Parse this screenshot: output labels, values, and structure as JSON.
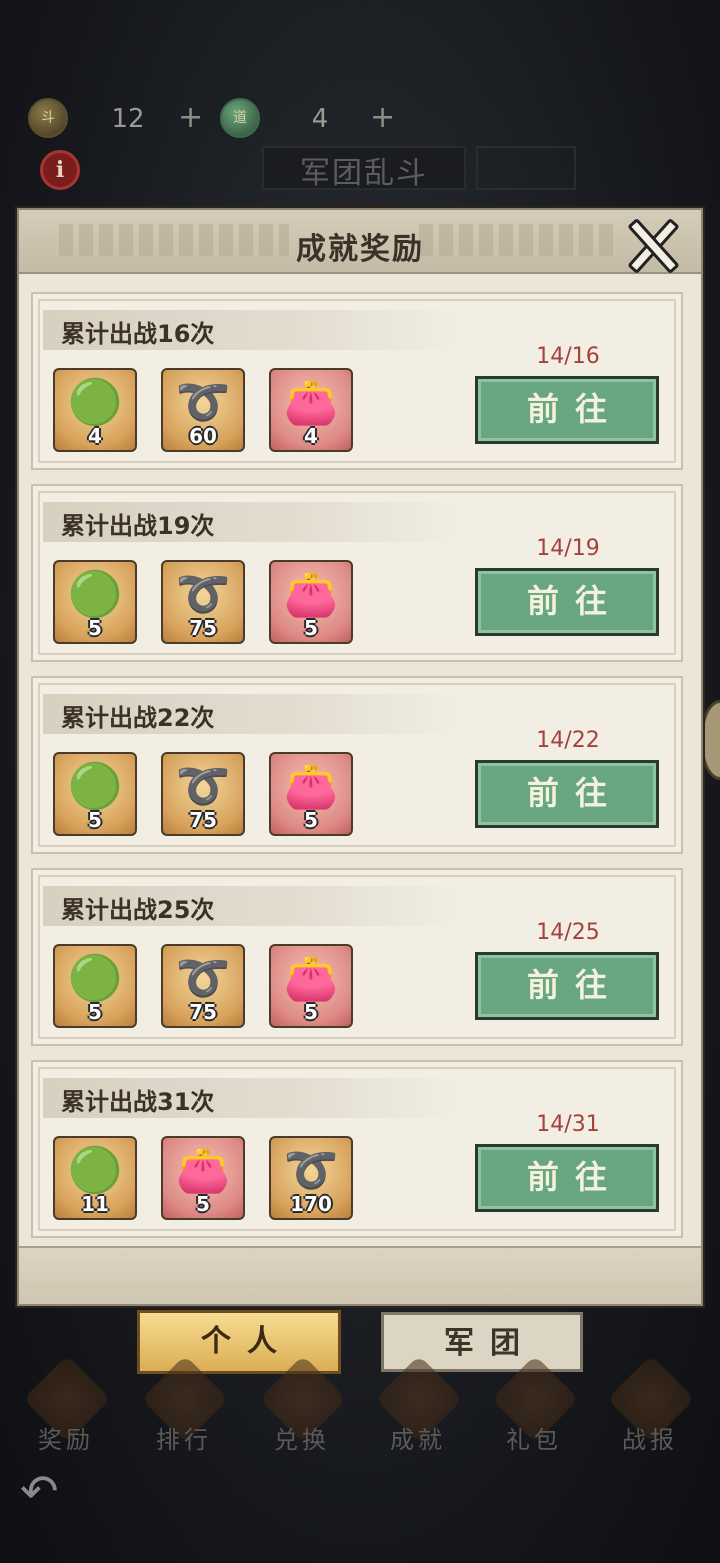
{
  "resources": [
    {
      "name": "斗",
      "value": "12",
      "plus": "+",
      "icon": "dou-token-icon"
    },
    {
      "name": "道",
      "value": "4",
      "plus": "+",
      "icon": "dao-token-icon"
    }
  ],
  "header": {
    "info_label": "i",
    "page_title": "军团乱斗"
  },
  "panel": {
    "title": "成就奖励",
    "go_label": "前往",
    "achievements": [
      {
        "title": "累计出战16次",
        "progress": "14/16",
        "rewards": [
          {
            "icon": "jade-pendant-icon",
            "qty": "4",
            "bg": "gold"
          },
          {
            "icon": "rope-bracelet-icon",
            "qty": "60",
            "bg": "gold"
          },
          {
            "icon": "treasure-bag-icon",
            "qty": "4",
            "bg": "red"
          }
        ]
      },
      {
        "title": "累计出战19次",
        "progress": "14/19",
        "rewards": [
          {
            "icon": "jade-pendant-icon",
            "qty": "5",
            "bg": "gold"
          },
          {
            "icon": "rope-bracelet-icon",
            "qty": "75",
            "bg": "gold"
          },
          {
            "icon": "treasure-bag-icon",
            "qty": "5",
            "bg": "red"
          }
        ]
      },
      {
        "title": "累计出战22次",
        "progress": "14/22",
        "rewards": [
          {
            "icon": "jade-pendant-icon",
            "qty": "5",
            "bg": "gold"
          },
          {
            "icon": "rope-bracelet-icon",
            "qty": "75",
            "bg": "gold"
          },
          {
            "icon": "treasure-bag-icon",
            "qty": "5",
            "bg": "red"
          }
        ]
      },
      {
        "title": "累计出战25次",
        "progress": "14/25",
        "rewards": [
          {
            "icon": "jade-pendant-icon",
            "qty": "5",
            "bg": "gold"
          },
          {
            "icon": "rope-bracelet-icon",
            "qty": "75",
            "bg": "gold"
          },
          {
            "icon": "treasure-bag-icon",
            "qty": "5",
            "bg": "red"
          }
        ]
      },
      {
        "title": "累计出战31次",
        "progress": "14/31",
        "rewards": [
          {
            "icon": "jade-pendant-icon",
            "qty": "11",
            "bg": "gold"
          },
          {
            "icon": "treasure-bag-icon",
            "qty": "5",
            "bg": "red"
          },
          {
            "icon": "rope-bracelet-icon",
            "qty": "170",
            "bg": "gold"
          }
        ]
      }
    ]
  },
  "tabs": {
    "personal": "个人",
    "legion": "军团",
    "active": "personal"
  },
  "bottom_nav": [
    {
      "label": "奖励",
      "icon": "reward-icon"
    },
    {
      "label": "排行",
      "icon": "ranking-icon"
    },
    {
      "label": "兑换",
      "icon": "exchange-icon"
    },
    {
      "label": "成就",
      "icon": "achievement-icon"
    },
    {
      "label": "礼包",
      "icon": "gift-pack-icon"
    },
    {
      "label": "战报",
      "icon": "battle-report-icon"
    }
  ],
  "colors": {
    "go_button": "#67a67e",
    "progress_text": "#a6413a",
    "active_tab": "#dcae55"
  }
}
